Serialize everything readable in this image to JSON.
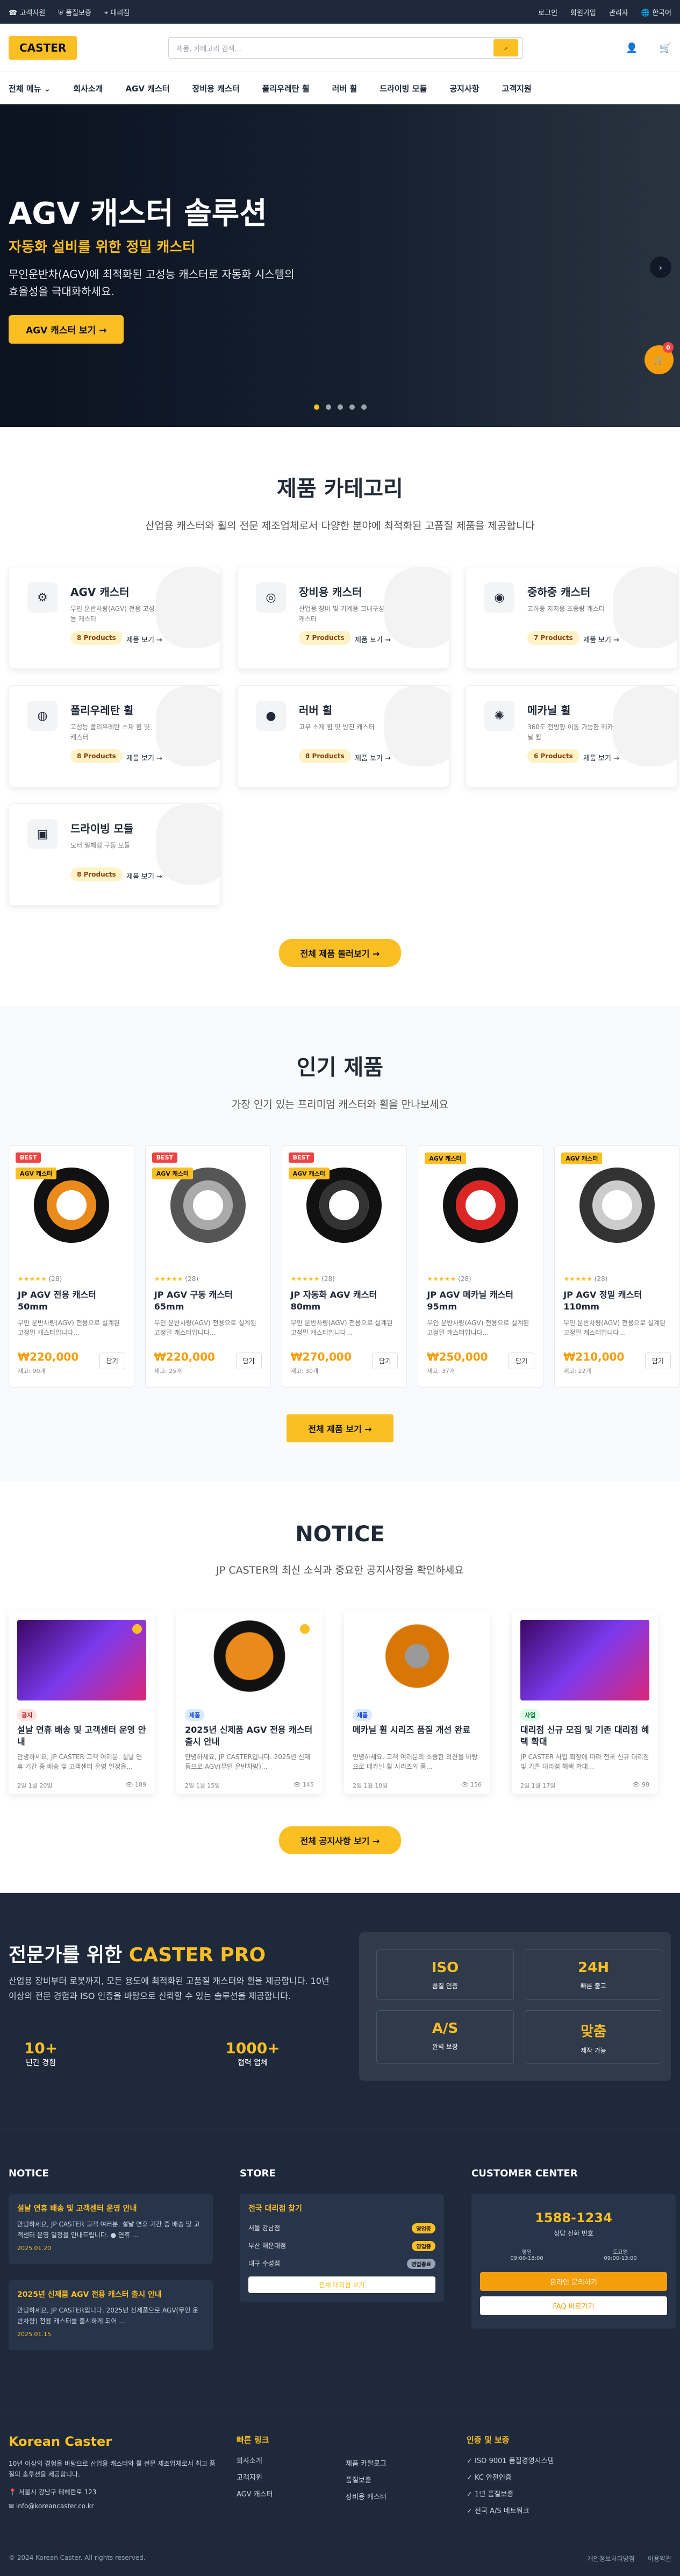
{
  "topbar": {
    "left": [
      "고객지원",
      "품질보증",
      "대리점"
    ],
    "right": [
      "로그인",
      "회원가입",
      "관리자",
      "한국어"
    ]
  },
  "header": {
    "logo": "CASTER",
    "search_placeholder": "제품, 카테고리 검색..."
  },
  "nav": [
    "전체 메뉴",
    "회사소개",
    "AGV 캐스터",
    "장비용 캐스터",
    "폴리우레탄 휠",
    "러버 휠",
    "드라이빙 모듈",
    "공지사항",
    "고객지원"
  ],
  "hero": {
    "title": "AGV 캐스터 솔루션",
    "subtitle": "자동화 설비를 위한 정밀 캐스터",
    "desc": "무인운반차(AGV)에 최적화된 고성능 캐스터로 자동화 시스템의 효율성을 극대화하세요.",
    "cta": "AGV 캐스터 보기",
    "cart_count": "0"
  },
  "categories": {
    "title": "제품 카테고리",
    "sub": "산업용 캐스터와 휠의 전문 제조업체로서 다양한 분야에 최적화된 고품질 제품을 제공합니다",
    "view": "제품 보기",
    "more": "전체 제품 둘러보기",
    "items": [
      {
        "name": "AGV 캐스터",
        "desc": "무인 운반차량(AGV) 전용 고성능 캐스터",
        "count": "8 Products"
      },
      {
        "name": "장비용 캐스터",
        "desc": "산업용 장비 및 기계용 고내구성 캐스터",
        "count": "7 Products"
      },
      {
        "name": "중하중 캐스터",
        "desc": "고하중 지지용 초중량 캐스터",
        "count": "7 Products"
      },
      {
        "name": "폴리우레탄 휠",
        "desc": "고성능 폴리우레탄 소재 휠 및 캐스터",
        "count": "8 Products"
      },
      {
        "name": "러버 휠",
        "desc": "고무 소재 휠 및 방진 캐스터",
        "count": "8 Products"
      },
      {
        "name": "메카닐 휠",
        "desc": "360도 전방향 이동 가능한 메카닐 휠",
        "count": "6 Products"
      },
      {
        "name": "드라이빙 모듈",
        "desc": "모터 일체형 구동 모듈",
        "count": "8 Products"
      }
    ]
  },
  "popular": {
    "title": "인기 제품",
    "sub": "가장 인기 있는 프리미엄 캐스터와 휠을 만나보세요",
    "add": "담기",
    "more": "전체 제품 보기",
    "items": [
      {
        "best": "BEST",
        "agv": "AGV 캐스터",
        "stars": "★★★★★",
        "reviews": "(28)",
        "name": "JP AGV 전용 캐스터 50mm",
        "desc": "무인 운반차량(AGV) 전용으로 설계된 고정밀 캐스터입니다...",
        "price": "₩220,000",
        "stock": "재고: 90개"
      },
      {
        "best": "BEST",
        "agv": "AGV 캐스터",
        "stars": "★★★★★",
        "reviews": "(28)",
        "name": "JP AGV 구동 캐스터 65mm",
        "desc": "무인 운반차량(AGV) 전용으로 설계된 고정밀 캐스터입니다...",
        "price": "₩220,000",
        "stock": "재고: 25개"
      },
      {
        "best": "BEST",
        "agv": "AGV 캐스터",
        "stars": "★★★★★",
        "reviews": "(28)",
        "name": "JP 자동화 AGV 캐스터 80mm",
        "desc": "무인 운반차량(AGV) 전용으로 설계된 고정밀 캐스터입니다...",
        "price": "₩270,000",
        "stock": "재고: 30개"
      },
      {
        "best": "",
        "agv": "AGV 캐스터",
        "stars": "★★★★★",
        "reviews": "(28)",
        "name": "JP AGV 메카닐 캐스터 95mm",
        "desc": "무인 운반차량(AGV) 전용으로 설계된 고정밀 캐스터입니다...",
        "price": "₩250,000",
        "stock": "재고: 37개"
      },
      {
        "best": "",
        "agv": "AGV 캐스터",
        "stars": "★★★★★",
        "reviews": "(28)",
        "name": "JP AGV 정밀 캐스터 110mm",
        "desc": "무인 운반차량(AGV) 전용으로 설계된 고정밀 캐스터입니다...",
        "price": "₩210,000",
        "stock": "재고: 22개"
      }
    ]
  },
  "notice": {
    "title": "NOTICE",
    "sub": "JP CASTER의 최신 소식과 중요한 공지사항을 확인하세요",
    "more": "전체 공지사항 보기",
    "items": [
      {
        "tag": "공지",
        "title": "설날 연휴 배송 및 고객센터 운영 안내",
        "desc": "안녕하세요, JP CASTER 고객 여러분. 설날 연휴 기간 중 배송 및 고객센터 운영 일정을...",
        "date": "2일 1월 20일",
        "views": "189"
      },
      {
        "tag": "제품",
        "title": "2025년 신제품 AGV 전용 캐스터 출시 안내",
        "desc": "안녕하세요, JP CASTER입니다. 2025년 신제품으로 AGV(무인 운반차량)...",
        "date": "2일 1월 15일",
        "views": "145"
      },
      {
        "tag": "제품",
        "title": "메카닐 휠 시리즈 품질 개선 완료",
        "desc": "안녕하세요. 고객 여러분의 소중한 의견을 바탕으로 메카닐 휠 시리즈의 품...",
        "date": "2일 1월 10일",
        "views": "156"
      },
      {
        "tag": "사업",
        "title": "대리점 신규 모집 및 기존 대리점 혜택 확대",
        "desc": "JP CASTER 사업 확장에 따라 전국 신규 대리점 및 기존 대리점 혜택 확대...",
        "date": "2일 1월 17일",
        "views": "98"
      }
    ]
  },
  "pro": {
    "title_a": "전문가를 위한 ",
    "title_b": "CASTER PRO",
    "desc": "산업용 장비부터 로봇까지, 모든 용도에 최적화된 고품질 캐스터와 휠을 제공합니다. 10년 이상의 전문 경험과 ISO 인증을 바탕으로 신뢰할 수 있는 솔루션을 제공합니다.",
    "stats": [
      {
        "v": "10+",
        "l": "년간 경험"
      },
      {
        "v": "1000+",
        "l": "협력 업체"
      }
    ],
    "boxes": [
      {
        "v": "ISO",
        "l": "품질 인증"
      },
      {
        "v": "24H",
        "l": "빠른 출고"
      },
      {
        "v": "A/S",
        "l": "완벽 보장"
      },
      {
        "v": "맞춤",
        "l": "제작 가능"
      }
    ]
  },
  "footer": {
    "notice_title": "NOTICE",
    "notices": [
      {
        "t": "설날 연휴 배송 및 고객센터 운영 안내",
        "d": "안녕하세요, JP CASTER 고객 여러분. 설날 연휴 기간 중 배송 및 고객센터 운영 일정을 안내드립니다. ● 연휴 ...",
        "dt": "2025.01.20"
      },
      {
        "t": "2025년 신제품 AGV 전용 캐스터 출시 안내",
        "d": "안녕하세요, JP CASTER입니다. 2025년 신제품으로 AGV(무인 운반차량) 전용 캐스터를 출시하게 되어 ...",
        "dt": "2025.01.15"
      }
    ],
    "store_title": "STORE",
    "store_box": "전국 대리점 찾기",
    "stores": [
      {
        "n": "서울 강남점",
        "s": "영업중"
      },
      {
        "n": "부산 해운대점",
        "s": "영업중"
      },
      {
        "n": "대구 수성점",
        "s": "영업종료"
      }
    ],
    "store_more": "전체 대리점 보기",
    "cs_title": "CUSTOMER CENTER",
    "phone": "1588-1234",
    "cs_sub": "상담 전화 번호",
    "wd": "평일",
    "wd_t": "09:00-18:00",
    "sat": "토요일",
    "sat_t": "09:00-13:00",
    "cs_b1": "온라인 문의하기",
    "cs_b2": "FAQ 바로가기",
    "brand": "Korean Caster",
    "brand_desc": "10년 이상의 경험을 바탕으로 산업용 캐스터와 휠 전문 제조업체로서 최고 품질의 솔루션을 제공합니다.",
    "addr": "서울시 강남구 테헤란로 123",
    "email": "info@koreancaster.co.kr",
    "quick_title": "빠른 링크",
    "quick1": [
      "회사소개",
      "고객지원",
      "AGV 캐스터"
    ],
    "quick2": [
      "제품 카탈로그",
      "품질보증",
      "장비용 캐스터"
    ],
    "cert_title": "인증 및 보증",
    "certs": [
      "ISO 9001 품질경영시스템",
      "KC 안전인증",
      "1년 품질보증",
      "전국 A/S 네트워크"
    ],
    "copy": "© 2024 Korean Caster. All rights reserved.",
    "links": [
      "개인정보처리방침",
      "이용약관"
    ]
  }
}
